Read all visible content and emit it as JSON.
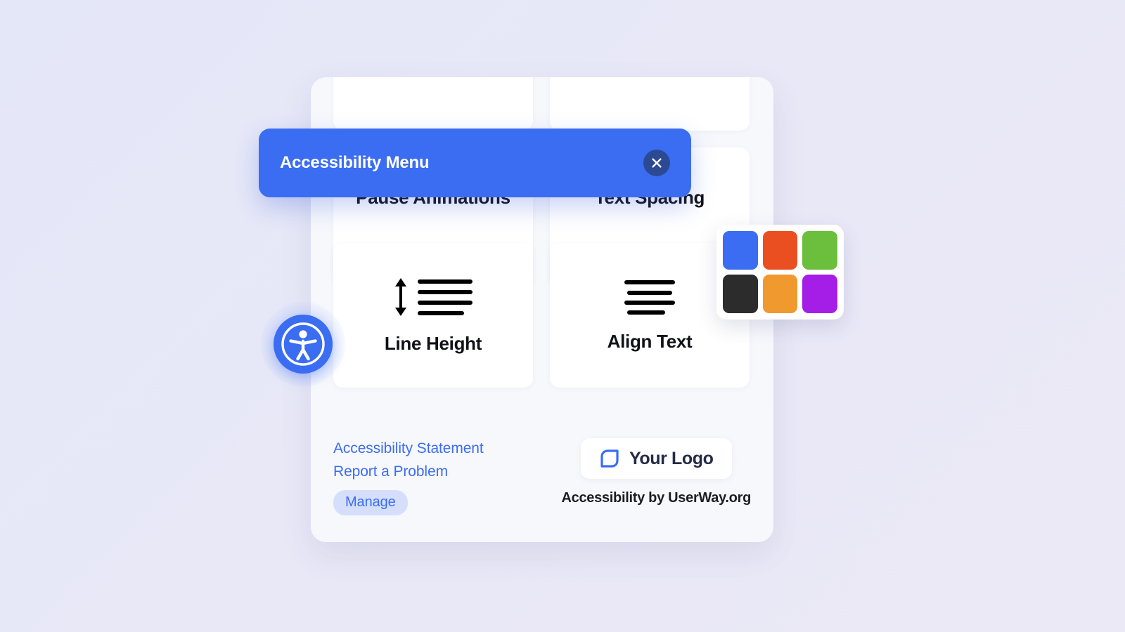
{
  "panel": {
    "tiles": [
      {
        "label": "",
        "icon": "",
        "state": "cut-off"
      },
      {
        "label": "",
        "icon": "",
        "state": "cut-off"
      },
      {
        "label": "Pause Animations",
        "icon": "pause-animations-icon"
      },
      {
        "label": "Text Spacing",
        "icon": "text-spacing-icon"
      },
      {
        "label": "Line Height",
        "icon": "line-height-icon"
      },
      {
        "label": "Align Text",
        "icon": "align-text-icon"
      }
    ]
  },
  "header": {
    "title": "Accessibility Menu",
    "close_label": "Close",
    "bar_color": "#3b6df2",
    "close_color": "#2c4a93"
  },
  "footer": {
    "links": [
      "Accessibility Statement",
      "Report a Problem"
    ],
    "manage_label": "Manage",
    "logo_text": "Your Logo",
    "credit": "Accessibility by UserWay.org",
    "link_color": "#3b6df2",
    "manage_bg": "#d5dffc"
  },
  "palette": {
    "swatches": [
      {
        "name": "blue",
        "color": "#3b6df2"
      },
      {
        "name": "red",
        "color": "#ea4f22"
      },
      {
        "name": "green",
        "color": "#6cbf3c"
      },
      {
        "name": "black",
        "color": "#2c2c2c"
      },
      {
        "name": "orange",
        "color": "#f0992e"
      },
      {
        "name": "purple",
        "color": "#a41ee8"
      }
    ]
  },
  "widget": {
    "label": "Open Accessibility Menu",
    "color": "#3b6df2"
  },
  "background": {
    "from": "#e4e7f8",
    "to": "#ece9f6"
  }
}
